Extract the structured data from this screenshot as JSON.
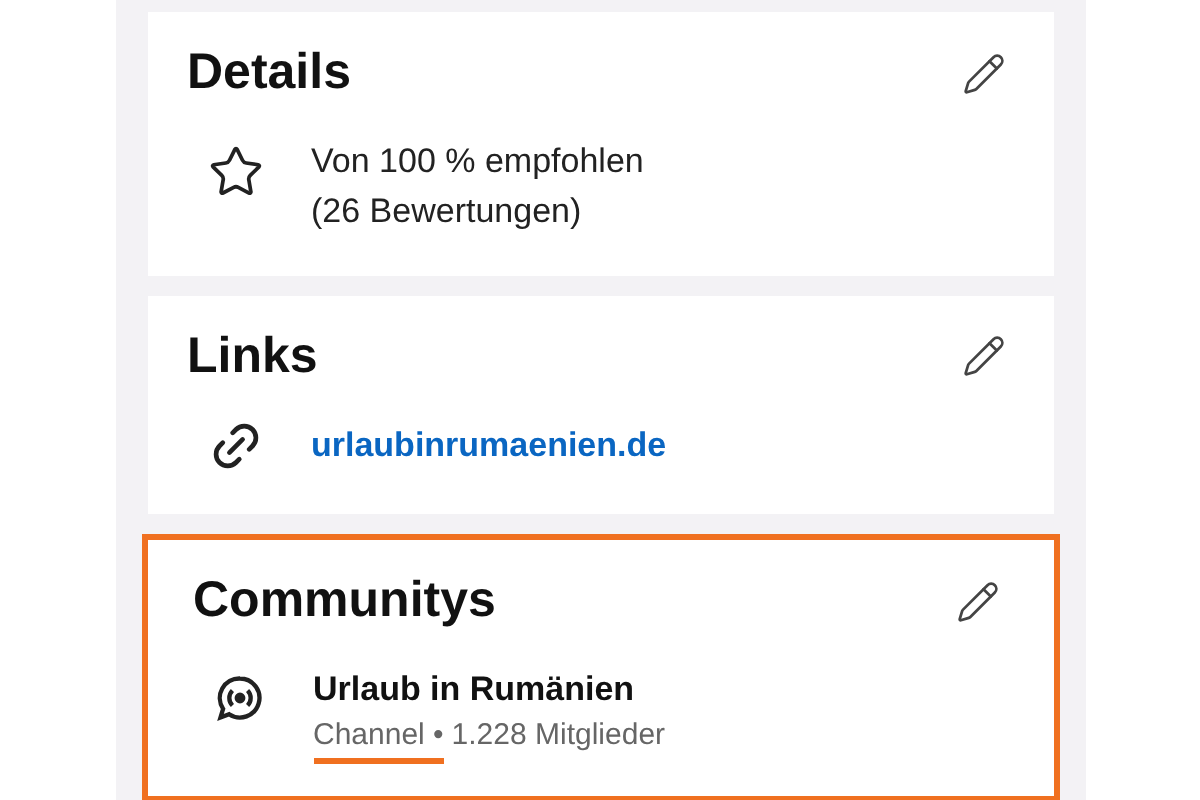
{
  "sections": [
    {
      "kind": "details",
      "title": "Details",
      "highlighted": false,
      "lines": [
        "Von 100 % empfohlen",
        "(26 Bewertungen)"
      ]
    },
    {
      "kind": "links",
      "title": "Links",
      "highlighted": false,
      "url": "urlaubinrumaenien.de"
    },
    {
      "kind": "communities",
      "title": "Communitys",
      "highlighted": true,
      "name": "Urlaub in Rumänien",
      "type": "Channel •",
      "type_underlined": true,
      "members": "1.228 Mitglieder"
    }
  ]
}
